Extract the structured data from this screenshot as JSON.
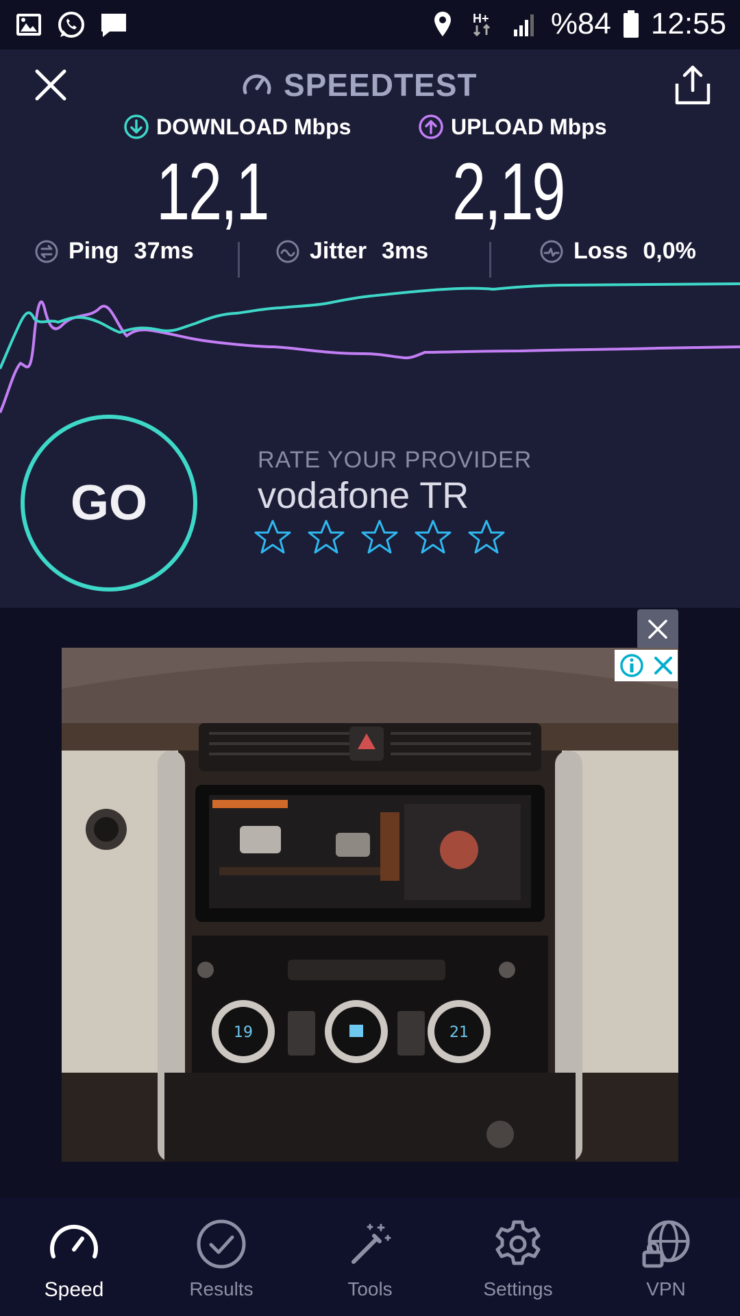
{
  "status_bar": {
    "battery": "%84",
    "time": "12:55",
    "network": "H+"
  },
  "header": {
    "title": "SPEEDTEST"
  },
  "results": {
    "download_label": "DOWNLOAD Mbps",
    "download_value": "12,1",
    "upload_label": "UPLOAD Mbps",
    "upload_value": "2,19",
    "ping_label": "Ping",
    "ping_value": "37ms",
    "jitter_label": "Jitter",
    "jitter_value": "3ms",
    "loss_label": "Loss",
    "loss_value": "0,0%"
  },
  "colors": {
    "download": "#3ed8c8",
    "upload": "#c27ff5",
    "background": "#1c1d36"
  },
  "go_button": {
    "label": "GO"
  },
  "rating": {
    "title": "RATE YOUR PROVIDER",
    "provider": "vodafone TR",
    "stars_total": 5,
    "stars_selected": 0
  },
  "ad": {
    "image_description_icon": "car-dashboard-ad-image"
  },
  "nav": {
    "items": [
      {
        "label": "Speed",
        "icon": "speedometer-icon",
        "active": true
      },
      {
        "label": "Results",
        "icon": "checkmark-circle-icon",
        "active": false
      },
      {
        "label": "Tools",
        "icon": "magic-wand-icon",
        "active": false
      },
      {
        "label": "Settings",
        "icon": "gear-icon",
        "active": false
      },
      {
        "label": "VPN",
        "icon": "globe-lock-icon",
        "active": false
      }
    ]
  }
}
